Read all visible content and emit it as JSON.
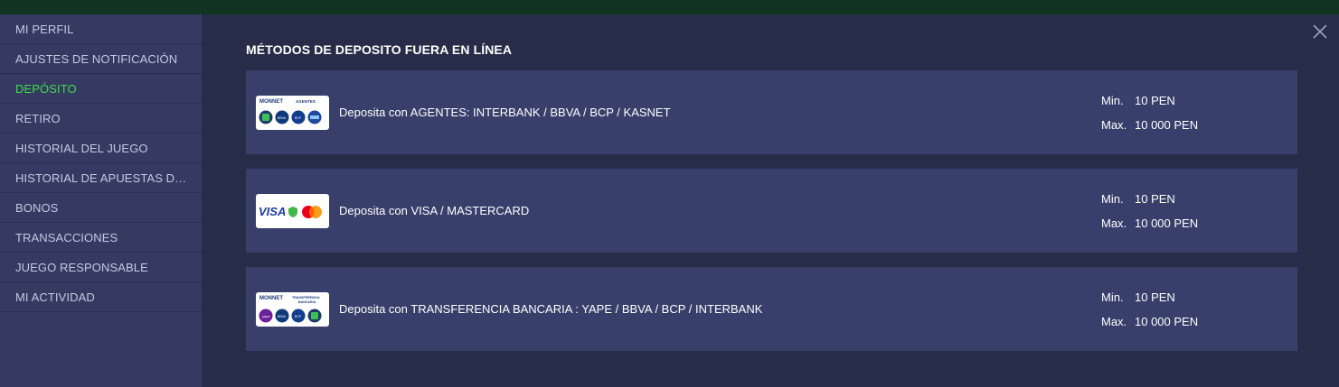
{
  "sidebar": {
    "items": [
      {
        "label": "MI PERFIL",
        "active": false
      },
      {
        "label": "AJUSTES DE NOTIFICACIÓN",
        "active": false
      },
      {
        "label": "DEPÓSITO",
        "active": true
      },
      {
        "label": "RETIRO",
        "active": false
      },
      {
        "label": "HISTORIAL DEL JUEGO",
        "active": false
      },
      {
        "label": "HISTORIAL DE APUESTAS DEPORTIVAS",
        "active": false
      },
      {
        "label": "BONOS",
        "active": false
      },
      {
        "label": "TRANSACCIONES",
        "active": false
      },
      {
        "label": "JUEGO RESPONSABLE",
        "active": false
      },
      {
        "label": "MI ACTIVIDAD",
        "active": false
      }
    ]
  },
  "main": {
    "title": "MÉTODOS DE DEPOSITO FUERA EN LÍNEA",
    "close_icon": "close-icon",
    "methods": [
      {
        "logo": {
          "brand": "MONNET",
          "tag": "AGENTES"
        },
        "description": "Deposita con AGENTES: INTERBANK / BBVA / BCP / KASNET",
        "min_label": "Min.",
        "min_value": "10 PEN",
        "max_label": "Max.",
        "max_value": "10 000 PEN"
      },
      {
        "logo": {
          "brand": "VISA",
          "tag": ""
        },
        "description": "Deposita con VISA / MASTERCARD",
        "min_label": "Min.",
        "min_value": "10 PEN",
        "max_label": "Max.",
        "max_value": "10 000 PEN"
      },
      {
        "logo": {
          "brand": "MONNET",
          "tag": "TRANSFERENCIA BANCARIA"
        },
        "description": "Deposita con TRANSFERENCIA BANCARIA : YAPE / BBVA / BCP / INTERBANK",
        "min_label": "Min.",
        "min_value": "10 PEN",
        "max_label": "Max.",
        "max_value": "10 000 PEN"
      }
    ]
  },
  "colors": {
    "modal_bg": "#272c49",
    "sidebar_bg": "#343a62",
    "card_bg": "#383f6b",
    "active": "#3fdc4b"
  }
}
